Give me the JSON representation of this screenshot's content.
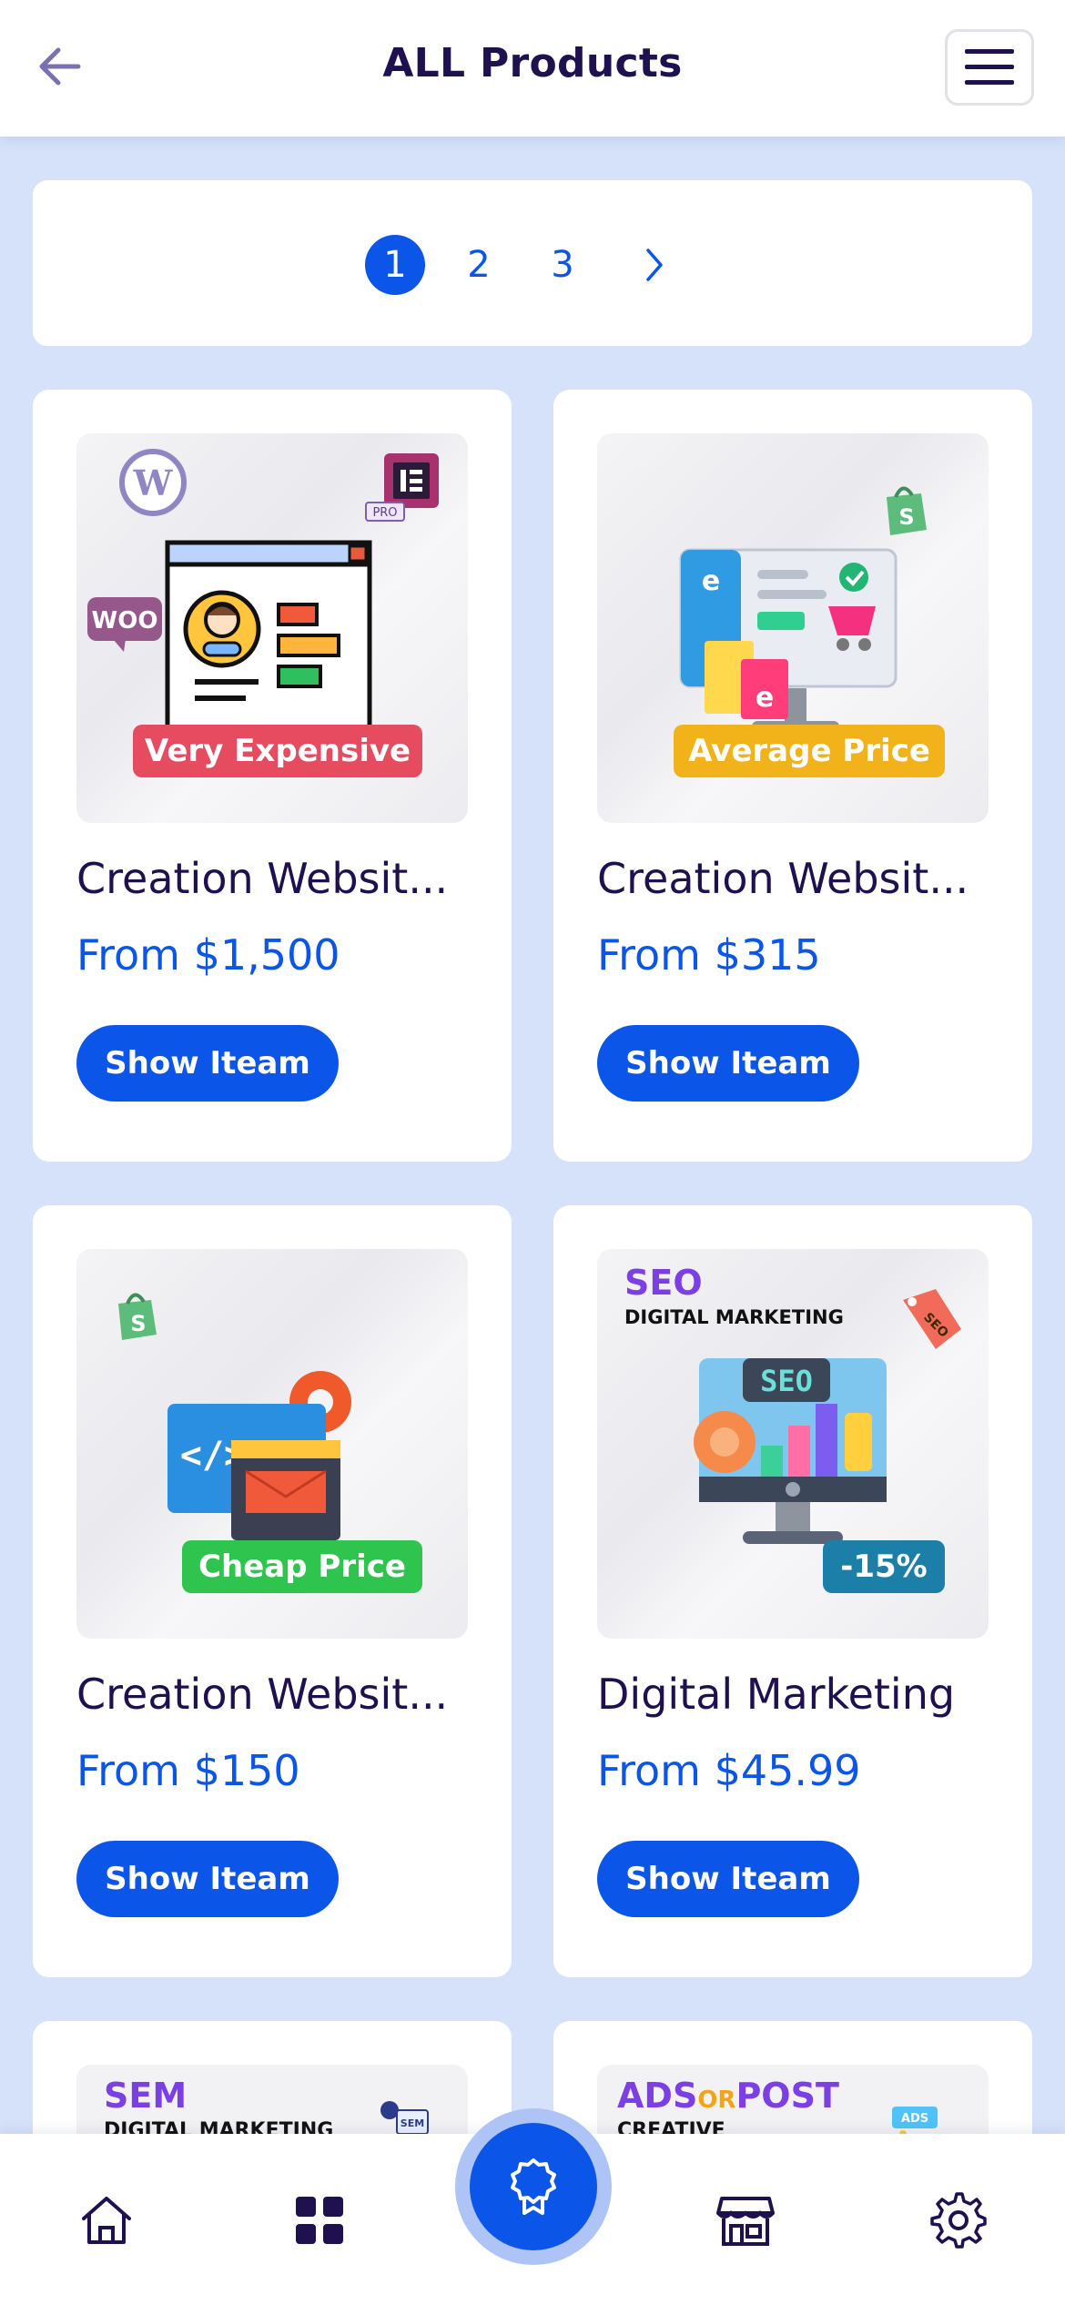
{
  "header": {
    "title": "ALL Products",
    "back_icon": "arrow-left-icon",
    "menu_icon": "hamburger-menu-icon"
  },
  "pagination": {
    "pages": [
      "1",
      "2",
      "3"
    ],
    "active": "1",
    "next_icon": "chevron-right-icon"
  },
  "products": [
    {
      "badge": "Very Expensive",
      "badge_color": "#e64b5f",
      "title": "Creation Websit...",
      "price": "From $1,500",
      "button": "Show Iteam",
      "image_art": {
        "woo_label": "WOO",
        "pro_label": "PRO"
      }
    },
    {
      "badge": "Average Price",
      "badge_color": "#f2b219",
      "title": "Creation Websit...",
      "price": "From $315",
      "button": "Show Iteam"
    },
    {
      "badge": "Cheap Price",
      "badge_color": "#2fc44e",
      "title": "Creation Websit...",
      "price": "From $150",
      "button": "Show Iteam"
    },
    {
      "badge": "-15%",
      "badge_color": "#1b7fa8",
      "title": "Digital Marketing",
      "price": "From $45.99",
      "button": "Show Iteam",
      "image_art": {
        "headline": "SEO",
        "subtitle": "DIGITAL MARKETING",
        "screen_label": "SEO",
        "tag_label": "SEO"
      }
    }
  ],
  "partial_products": [
    {
      "headline": "SEM",
      "subtitle": "DIGITAL MARKETING",
      "corner_label": "SEM"
    },
    {
      "headline_a": "ADS",
      "headline_or": "OR",
      "headline_b": "POST",
      "subtitle": "CREATIVE",
      "corner_label": "ADS"
    }
  ],
  "bottom_nav": {
    "items": [
      "home-icon",
      "grid-icon",
      "badge-award-icon",
      "store-icon",
      "settings-gear-icon"
    ],
    "active": "badge-award-icon"
  },
  "colors": {
    "primary": "#0b56e8",
    "title_text": "#1f1150",
    "background": "#d6e2fa"
  }
}
